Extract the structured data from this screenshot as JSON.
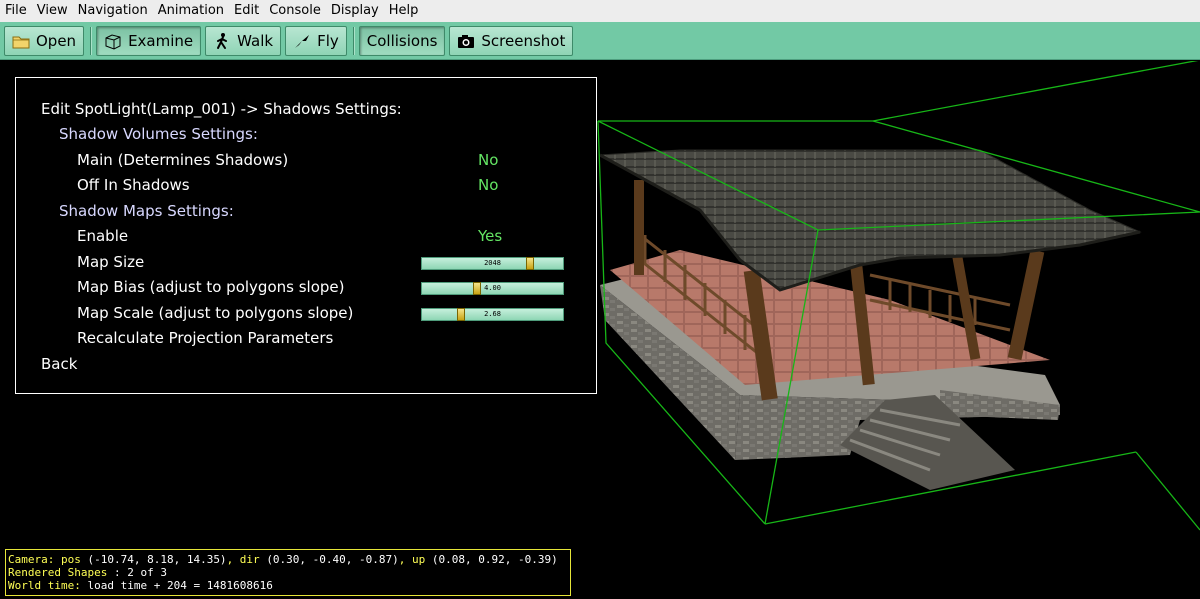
{
  "menubar": {
    "items": [
      "File",
      "View",
      "Navigation",
      "Animation",
      "Edit",
      "Console",
      "Display",
      "Help"
    ]
  },
  "toolbar": {
    "buttons": [
      {
        "label": "Open",
        "icon": "folder-icon"
      },
      {
        "label": "Examine",
        "icon": "cube-icon",
        "pressed": true
      },
      {
        "label": "Walk",
        "icon": "walk-icon"
      },
      {
        "label": "Fly",
        "icon": "fly-icon"
      },
      {
        "label": "Collisions",
        "pressed": true
      },
      {
        "label": "Screenshot",
        "icon": "camera-icon"
      }
    ],
    "colors": {
      "bar": "#72c9a5",
      "button": "#8fd4b5"
    }
  },
  "panel": {
    "title": "Edit SpotLight(Lamp_001) -> Shadows Settings:",
    "volumes_header": "Shadow Volumes Settings:",
    "main_label": "Main (Determines Shadows)",
    "main_value": "No",
    "off_in_shadows_label": "Off In Shadows",
    "off_in_shadows_value": "No",
    "maps_header": "Shadow Maps Settings:",
    "enable_label": "Enable",
    "enable_value": "Yes",
    "map_size_label": "Map Size",
    "map_size_value": "2048",
    "map_size_fraction": 0.78,
    "map_bias_label": "Map Bias (adjust to polygons slope)",
    "map_bias_value": "4.00",
    "map_bias_fraction": 0.38,
    "map_scale_label": "Map Scale (adjust to polygons slope)",
    "map_scale_value": "2.68",
    "map_scale_fraction": 0.26,
    "recalc_label": "Recalculate Projection Parameters",
    "back_label": "Back",
    "colors": {
      "value": "#64e664",
      "header": "#d8d8ff"
    }
  },
  "status": {
    "camera_prefix": "Camera: pos ",
    "camera_pos": "(-10.74, 8.18, 14.35)",
    "dir_prefix": ", dir ",
    "camera_dir": "(0.30, -0.40, -0.87)",
    "up_prefix": ", up ",
    "camera_up": "(0.08, 0.92, -0.39)",
    "rendered_label": "Rendered Shapes",
    "rendered_value": " : 2 of 3",
    "world_label": "World time:",
    "world_value": " load time + 204 = 1481608616",
    "colors": {
      "label": "#ffff55",
      "value": "#ffffff",
      "border": "#e6e639"
    }
  }
}
